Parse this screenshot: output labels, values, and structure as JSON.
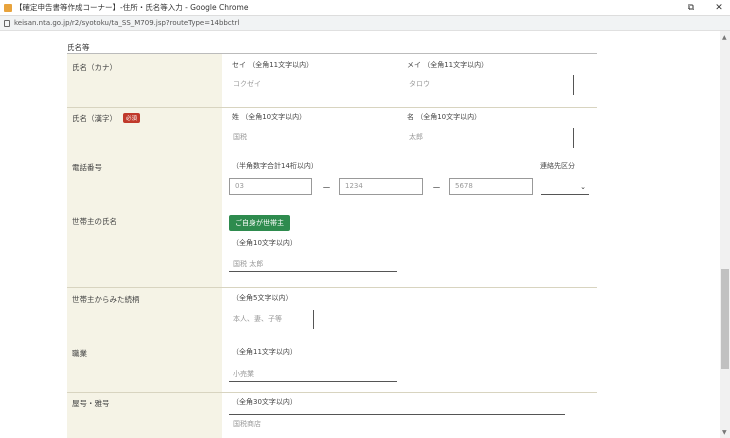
{
  "window": {
    "title": "【確定申告書等作成コーナー】-住所・氏名等入力 - Google Chrome",
    "url": "keisan.nta.go.jp/r2/syotoku/ta_SS_M709.jsp?routeType=14bbctrl"
  },
  "section": {
    "heading": "氏名等"
  },
  "rows": {
    "kana": {
      "label": "氏名（カナ）",
      "sei_hint": "セイ （全角11文字以内）",
      "sei_value": "コクゼイ",
      "mei_hint": "メイ （全角11文字以内）",
      "mei_value": "タロウ"
    },
    "kanji": {
      "label": "氏名（漢字）",
      "required_badge": "必須",
      "sei_hint": "姓 （全角10文字以内）",
      "sei_value": "国税",
      "mei_hint": "名 （全角10文字以内）",
      "mei_value": "太郎"
    },
    "phone": {
      "label": "電話番号",
      "hint": "（半角数字合計14桁以内）",
      "part1": "03",
      "part2": "1234",
      "part3": "5678",
      "separator": "－",
      "contact_label": "連絡先区分",
      "contact_value": ""
    },
    "householder": {
      "label": "世帯主の氏名",
      "button": "ご自身が世帯主",
      "hint": "（全角10文字以内）",
      "value": "国税 太郎"
    },
    "relation": {
      "label": "世帯主からみた続柄",
      "hint": "（全角5文字以内）",
      "placeholder": "本人、妻、子等"
    },
    "occupation": {
      "label": "職業",
      "hint": "（全角11文字以内）",
      "value": "小売業"
    },
    "shop": {
      "label": "屋号・雅号",
      "hint": "（全角30文字以内）",
      "value": "国税商店"
    }
  }
}
